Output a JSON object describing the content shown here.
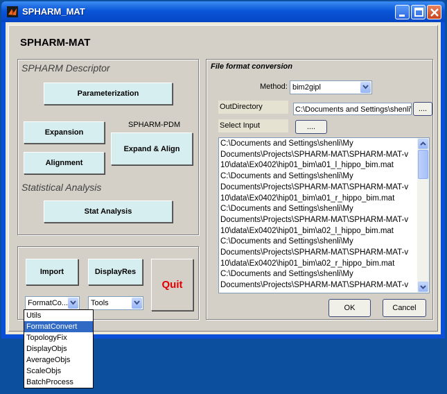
{
  "window": {
    "title": "SPHARM_MAT"
  },
  "heading": "SPHARM-MAT",
  "descriptor": {
    "section_label": "SPHARM Descriptor",
    "parameterization": "Parameterization",
    "expansion": "Expansion",
    "alignment": "Alignment",
    "pdm_label": "SPHARM-PDM",
    "expand_align": "Expand & Align",
    "stat_label": "Statistical Analysis",
    "stat_analysis": "Stat Analysis"
  },
  "bottom": {
    "import": "Import",
    "displayres": "DisplayRes",
    "quit": "Quit",
    "utils_select": "FormatCo...",
    "tools_select": "Tools"
  },
  "conversion": {
    "section_label": "File format conversion",
    "method_label": "Method:",
    "method_value": "bim2gipl",
    "outdir_label": "OutDirectory",
    "outdir_value": "C:\\Documents and Settings\\shenli\\M",
    "browse": "....",
    "select_input_label": "Select Input",
    "files": [
      "C:\\Documents and Settings\\shenli\\My",
      "Documents\\Projects\\SPHARM-MAT\\SPHARM-MAT-v",
      "10\\data\\Ex0402\\hip01_bim\\a01_l_hippo_bim.mat",
      "C:\\Documents and Settings\\shenli\\My",
      "Documents\\Projects\\SPHARM-MAT\\SPHARM-MAT-v",
      "10\\data\\Ex0402\\hip01_bim\\a01_r_hippo_bim.mat",
      "C:\\Documents and Settings\\shenli\\My",
      "Documents\\Projects\\SPHARM-MAT\\SPHARM-MAT-v",
      "10\\data\\Ex0402\\hip01_bim\\a02_l_hippo_bim.mat",
      "C:\\Documents and Settings\\shenli\\My",
      "Documents\\Projects\\SPHARM-MAT\\SPHARM-MAT-v",
      "10\\data\\Ex0402\\hip01_bim\\a02_r_hippo_bim.mat",
      "C:\\Documents and Settings\\shenli\\My",
      "Documents\\Projects\\SPHARM-MAT\\SPHARM-MAT-v"
    ],
    "ok": "OK",
    "cancel": "Cancel"
  },
  "dropdown_options": [
    "Utils",
    "FormatConvert",
    "TopologyFix",
    "DisplayObjs",
    "AverageObjs",
    "ScaleObjs",
    "BatchProcess"
  ],
  "colors": {
    "titlebar": "#0a56d8",
    "button_face": "#d6eef0",
    "quit": "#e00000",
    "selection": "#316ac5"
  }
}
